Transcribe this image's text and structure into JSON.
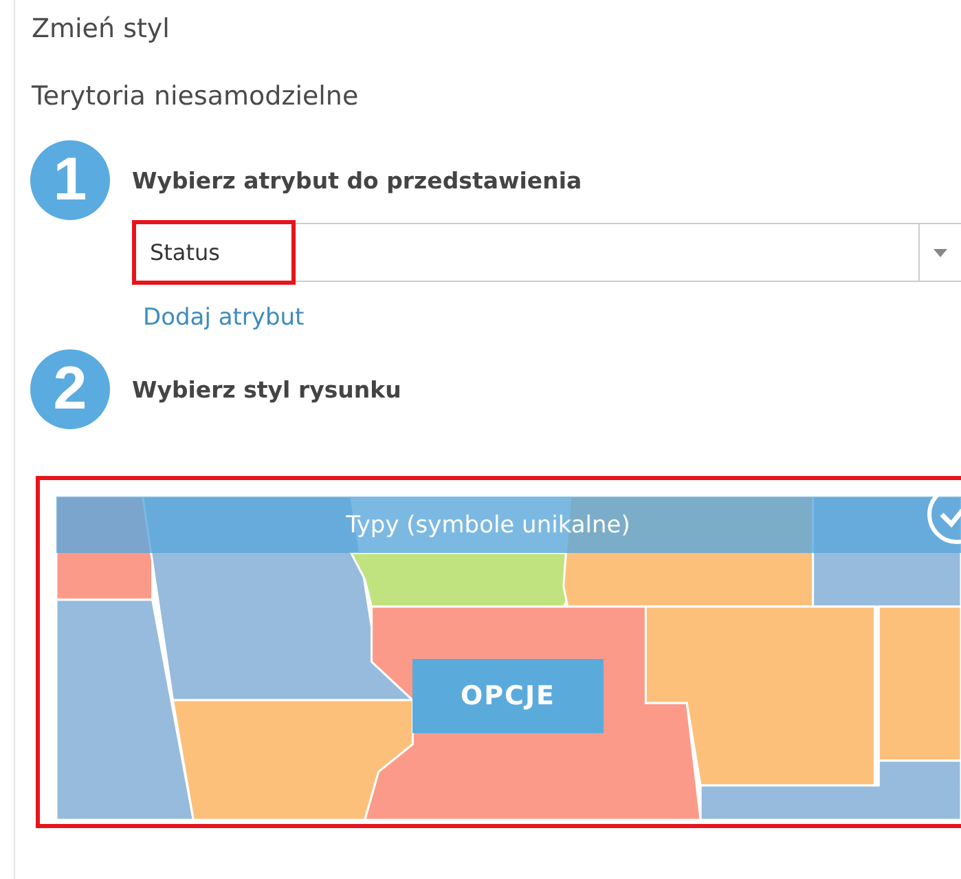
{
  "panel_title": "Zmień styl",
  "layer_name": "Terytoria niesamodzielne",
  "steps": [
    {
      "number": "1",
      "label": "Wybierz atrybut do przedstawienia"
    },
    {
      "number": "2",
      "label": "Wybierz styl rysunku"
    }
  ],
  "attribute_field": {
    "value": "Status",
    "highlighted": true
  },
  "add_attribute_link": "Dodaj atrybut",
  "style_card": {
    "label": "Typy (symbole unikalne)",
    "button": "OPCJE",
    "selected": true,
    "highlighted": true
  }
}
